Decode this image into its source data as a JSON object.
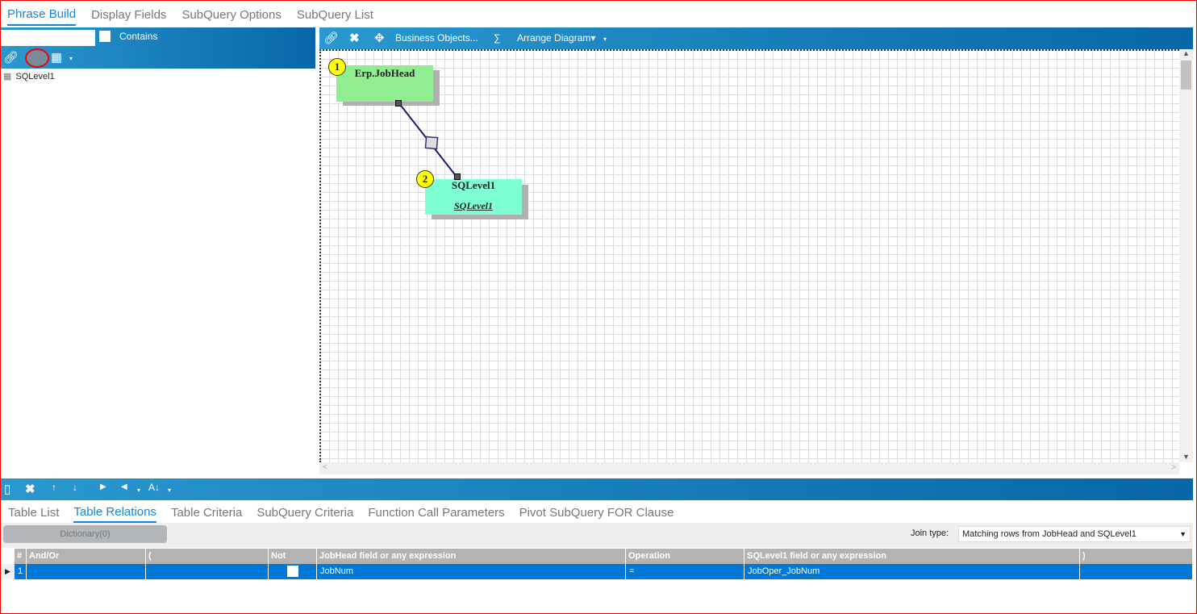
{
  "top_tabs": [
    {
      "label": "Phrase Build"
    },
    {
      "label": "Display Fields"
    },
    {
      "label": "SubQuery Options"
    },
    {
      "label": "SubQuery List"
    }
  ],
  "left_panel": {
    "search_value": "",
    "contains_label": "Contains",
    "tree_items": [
      {
        "label": "SQLevel1"
      }
    ]
  },
  "diagram_toolbar": {
    "business_objects": "Business Objects...",
    "sigma": "∑",
    "arrange": "Arrange Diagram"
  },
  "diagram": {
    "tables": [
      {
        "number": "1",
        "name": "Erp.JobHead",
        "alias": ""
      },
      {
        "number": "2",
        "name": "SQLevel1",
        "alias": "SQLevel1"
      }
    ]
  },
  "bottom_tabs": [
    {
      "label": "Table List"
    },
    {
      "label": "Table Relations"
    },
    {
      "label": "Table Criteria"
    },
    {
      "label": "SubQuery Criteria"
    },
    {
      "label": "Function Call Parameters"
    },
    {
      "label": "Pivot SubQuery FOR Clause"
    }
  ],
  "dictionary_button": "Dictionary(0)",
  "join_type": {
    "label": "Join type:",
    "value": "Matching rows from JobHead and SQLevel1"
  },
  "grid": {
    "columns": [
      "#",
      "And/Or",
      "(",
      "Not",
      "JobHead field or any expression",
      "Operation",
      "SQLevel1 field or any expression",
      ")"
    ],
    "rows": [
      {
        "num": "1",
        "and_or": "",
        "open": "",
        "not": false,
        "left": "JobNum",
        "op": "=",
        "right": "JobOper_JobNum",
        "close": ""
      }
    ]
  },
  "colors": {
    "accent": "#1a86d0",
    "selected_row": "#0078d7",
    "jobhead_box": "#90ee90",
    "sqlevel_box": "#7fffd4"
  }
}
